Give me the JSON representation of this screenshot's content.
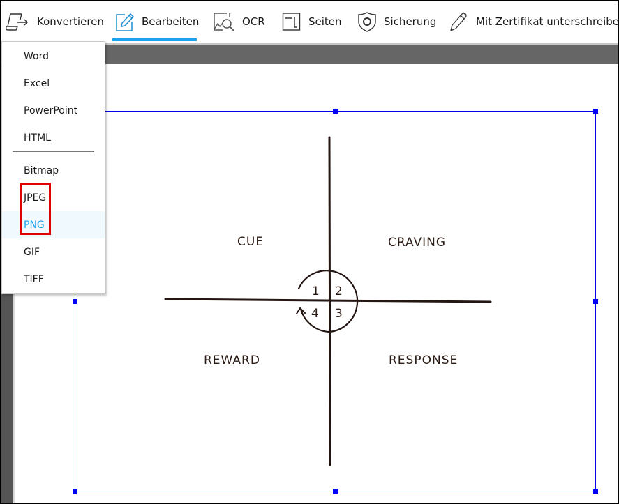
{
  "toolbar": {
    "items": [
      {
        "id": "konvertieren",
        "label": "Konvertieren",
        "icon": "convert-icon",
        "active": false
      },
      {
        "id": "bearbeiten",
        "label": "Bearbeiten",
        "icon": "edit-pencil-icon",
        "active": true
      },
      {
        "id": "ocr",
        "label": "OCR",
        "icon": "ocr-image-search-icon",
        "active": false
      },
      {
        "id": "seiten",
        "label": "Seiten",
        "icon": "pages-icon",
        "active": false
      },
      {
        "id": "sicherung",
        "label": "Sicherung",
        "icon": "shield-icon",
        "active": false
      },
      {
        "id": "zertifikat",
        "label": "Mit Zertifikat unterschreiben",
        "icon": "pen-sign-icon",
        "active": false
      }
    ],
    "accent_color": "#1aa3e8"
  },
  "convert_menu": {
    "items": [
      {
        "label": "Word"
      },
      {
        "label": "Excel"
      },
      {
        "label": "PowerPoint"
      },
      {
        "label": "HTML"
      },
      {
        "label": "Bitmap"
      },
      {
        "label": "JPEG"
      },
      {
        "label": "PNG",
        "hovered": true
      },
      {
        "label": "GIF"
      },
      {
        "label": "TIFF"
      }
    ],
    "highlight_box_color": "#e00000",
    "highlighted_items": [
      "JPEG",
      "PNG"
    ]
  },
  "document": {
    "selection_color": "#0000ff",
    "diagram": {
      "quadrant_labels": {
        "top_left": "CUE",
        "top_right": "CRAVING",
        "bottom_right": "RESPONSE",
        "bottom_left": "REWARD"
      },
      "cycle_numbers": {
        "q1": "1",
        "q2": "2",
        "q3": "3",
        "q4": "4"
      }
    }
  }
}
